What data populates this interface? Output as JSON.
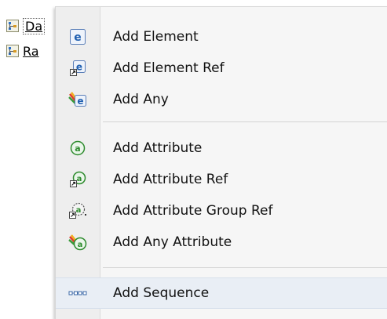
{
  "tree": {
    "items": [
      {
        "label": "Da",
        "icon": "xsd-node-icon"
      },
      {
        "label": "Ra",
        "icon": "xsd-node-icon"
      }
    ]
  },
  "menu": {
    "items": [
      {
        "label": "Add Element",
        "icon": "element-icon"
      },
      {
        "label": "Add Element Ref",
        "icon": "element-ref-icon"
      },
      {
        "label": "Add Any",
        "icon": "any-element-icon"
      },
      {
        "label": "Add Attribute",
        "icon": "attribute-icon"
      },
      {
        "label": "Add Attribute Ref",
        "icon": "attribute-ref-icon"
      },
      {
        "label": "Add Attribute Group Ref",
        "icon": "attribute-group-ref-icon"
      },
      {
        "label": "Add Any Attribute",
        "icon": "any-attribute-icon"
      },
      {
        "label": "Add Sequence",
        "icon": "sequence-icon"
      }
    ]
  },
  "colors": {
    "element_icon": "#1f5fb0",
    "attribute_icon": "#2e8b2e",
    "selection": "#e9eef5"
  }
}
